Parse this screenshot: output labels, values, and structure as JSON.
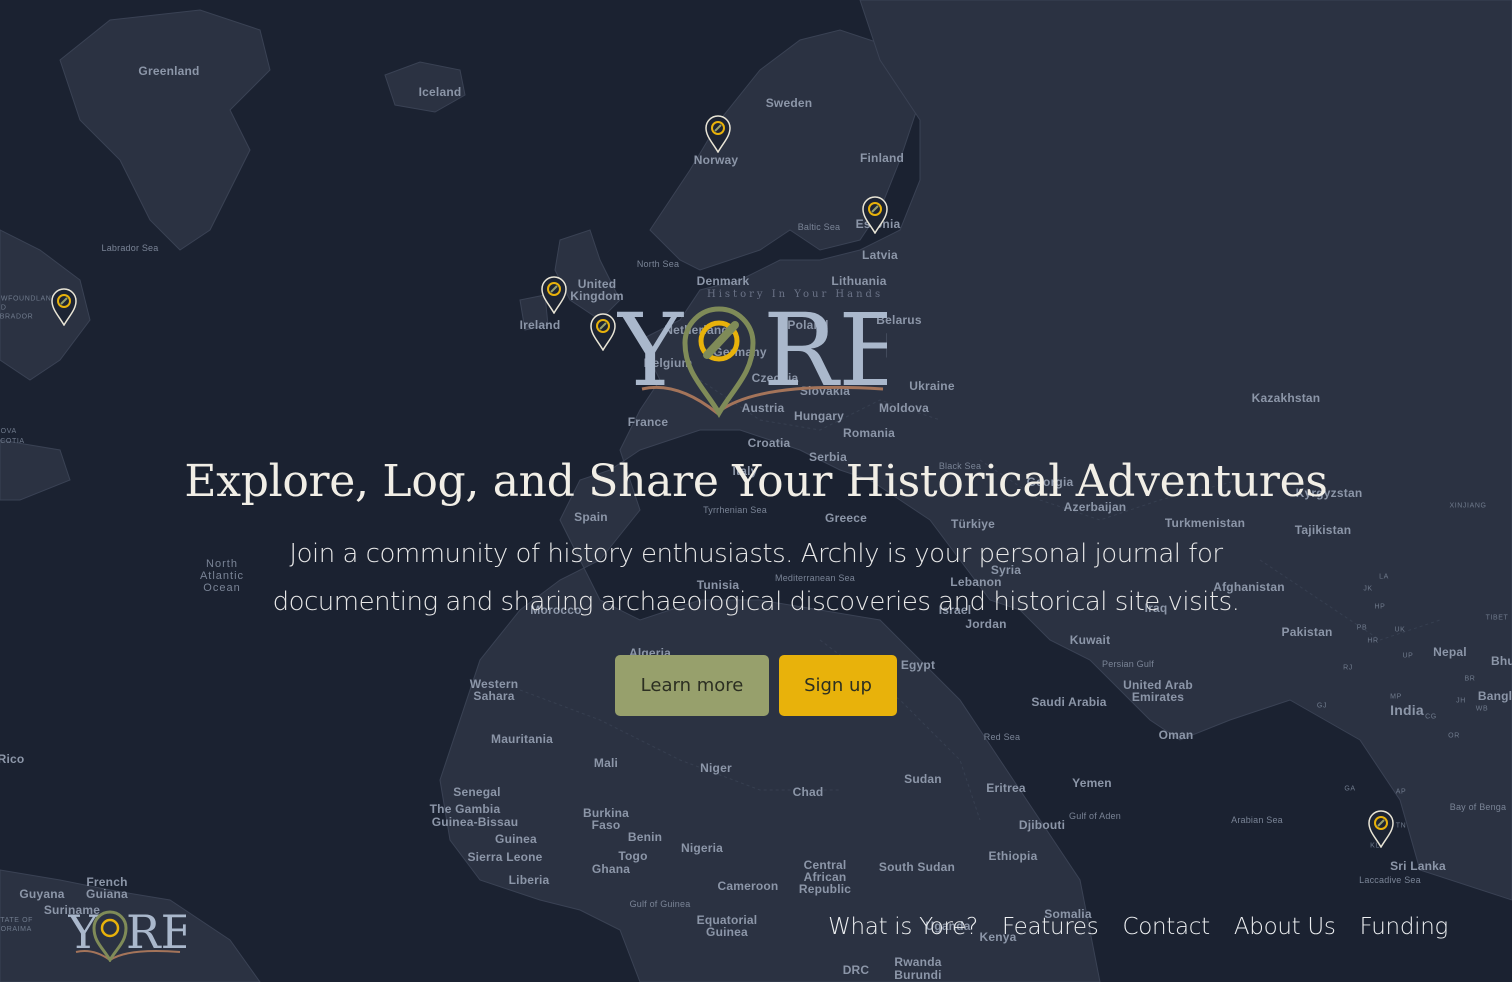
{
  "hero": {
    "logo_text": "YORE",
    "tagline": "History In Your Hands",
    "headline": "Explore, Log, and Share Your Historical Adventures",
    "subheading": "Join a community of history enthusiasts. Archly is your personal journal for documenting and sharing archaeological discoveries and historical site visits.",
    "buttons": {
      "learn_more": "Learn more",
      "sign_up": "Sign up"
    }
  },
  "footer": {
    "logo_text": "YORE",
    "nav": [
      {
        "label": "What is Yore?"
      },
      {
        "label": "Features"
      },
      {
        "label": "Contact"
      },
      {
        "label": "About Us"
      },
      {
        "label": "Funding"
      }
    ]
  },
  "map": {
    "labels": {
      "greenland": "Greenland",
      "iceland": "Iceland",
      "sweden": "Sweden",
      "norway": "Norway",
      "finland": "Finland",
      "estonia": "Estonia",
      "latvia": "Latvia",
      "lithuania": "Lithuania",
      "denmark": "Denmark",
      "united_kingdom": "United Kingdom",
      "ireland": "Ireland",
      "netherlands": "Netherlands",
      "belgium": "Belgium",
      "germany": "Germany",
      "poland": "Poland",
      "belarus": "Belarus",
      "ukraine": "Ukraine",
      "czechia": "Czechia",
      "slovakia": "Slovakia",
      "austria": "Austria",
      "hungary": "Hungary",
      "moldova": "Moldova",
      "romania": "Romania",
      "croatia": "Croatia",
      "serbia": "Serbia",
      "france": "France",
      "italy": "Italy",
      "spain": "Spain",
      "greece": "Greece",
      "turkiye": "Türkiye",
      "kazakhstan": "Kazakhstan",
      "kyrgyzstan": "Kyrgyzstan",
      "turkmenistan": "Turkmenistan",
      "tajikistan": "Tajikistan",
      "azerbaijan": "Azerbaijan",
      "georgia": "Georgia",
      "syria": "Syria",
      "lebanon": "Lebanon",
      "israel": "Israel",
      "jordan": "Jordan",
      "iraq": "Iraq",
      "kuwait": "Kuwait",
      "afghanistan": "Afghanistan",
      "pakistan": "Pakistan",
      "nepal": "Nepal",
      "india": "India",
      "bhutan": "Bhu",
      "bangladesh": "Bangl",
      "sri_lanka": "Sri Lanka",
      "saudi_arabia": "Saudi Arabia",
      "uae": "United Arab Emirates",
      "oman": "Oman",
      "yemen": "Yemen",
      "egypt": "Egypt",
      "sudan": "Sudan",
      "south_sudan": "South Sudan",
      "eritrea": "Eritrea",
      "ethiopia": "Ethiopia",
      "djibouti": "Djibouti",
      "somalia": "Somalia",
      "chad": "Chad",
      "niger": "Niger",
      "mali": "Mali",
      "mauritania": "Mauritania",
      "western_sahara": "Western Sahara",
      "algeria": "Algeria",
      "morocco": "Morocco",
      "tunisia": "Tunisia",
      "senegal": "Senegal",
      "the_gambia": "The Gambia",
      "guinea_bissau": "Guinea-Bissau",
      "guinea": "Guinea",
      "sierra_leone": "Sierra Leone",
      "liberia": "Liberia",
      "burkina_faso": "Burkina Faso",
      "ghana": "Ghana",
      "togo": "Togo",
      "benin": "Benin",
      "nigeria": "Nigeria",
      "cameroon": "Cameroon",
      "central_african_republic": "Central African Republic",
      "equatorial_guinea": "Equatorial Guinea",
      "kenya": "Kenya",
      "drc": "DRC",
      "rwanda": "Rwanda",
      "burundi": "Burundi",
      "uganda": "Uganda",
      "guyana": "Guyana",
      "suriname": "Suriname",
      "french_guiana": "French Guiana",
      "rico": "Rico",
      "north_sea": "North Sea",
      "baltic_sea": "Baltic Sea",
      "black_sea": "Black Sea",
      "mediterranean_sea": "Mediterranean Sea",
      "tyrrhenian_sea": "Tyrrhenian Sea",
      "red_sea": "Red Sea",
      "persian_gulf": "Persian Gulf",
      "gulf_of_aden": "Gulf of Aden",
      "arabian_sea": "Arabian Sea",
      "laccadive_sea": "Laccadive Sea",
      "bay_of_bengal": "Bay of Benga",
      "gulf_of_guinea": "Gulf of Guinea",
      "labrador_sea": "Labrador Sea",
      "north_atlantic_ocean": "North Atlantic Ocean",
      "xinjiang": "XINJIANG",
      "tibet": "TIBET",
      "newfoundland": "NEWFOUNDLAND AND LABRADOR",
      "nova_scotia": "NOVA SCOTIA",
      "state_of_roraima": "STATE OF RORAIMA",
      "ladakh": "LA",
      "jk": "JK",
      "hp": "HP",
      "pb": "PB",
      "hr": "HR",
      "uk": "UK",
      "up": "UP",
      "rj": "RJ",
      "gj": "GJ",
      "mp": "MP",
      "cg": "CG",
      "jh": "JH",
      "wb": "WB",
      "br": "BR",
      "or": "OR",
      "ga": "GA",
      "ap": "AP",
      "kl": "KL",
      "tn": "TN"
    }
  }
}
